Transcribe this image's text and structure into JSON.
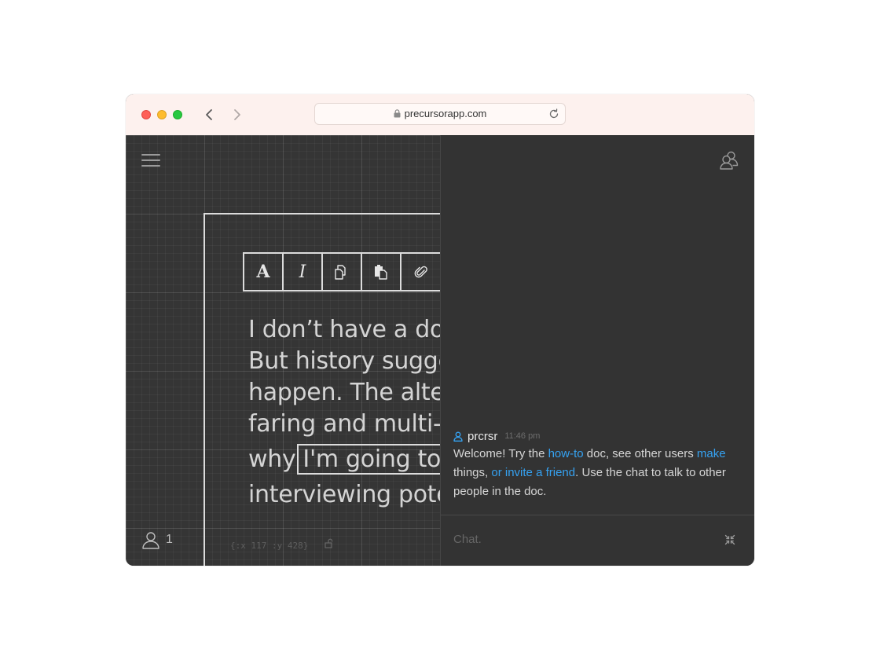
{
  "browser": {
    "url": "precursorapp.com"
  },
  "canvas": {
    "toolbar": {
      "bold_label": "A",
      "italic_label": "I"
    },
    "document_lines": [
      "I don’t have a doc",
      "But history sugge",
      "happen.  The alter",
      "faring and multi-p",
      "why",
      "I'm going to r",
      "interviewing pote"
    ],
    "user_count": "1",
    "coordinates": "{:x 117 :y 428}"
  },
  "chat": {
    "message": {
      "author": "prcrsr",
      "time": "11:46 pm",
      "text_1": "Welcome! Try the ",
      "link_howto": "how-to",
      "text_2": " doc, see other users ",
      "link_make": "make",
      "text_3": "things, ",
      "link_invite": "or invite a friend",
      "text_4": ". Use the chat to talk to other people in the doc."
    },
    "input_placeholder": "Chat."
  },
  "colors": {
    "background": "#333333",
    "link": "#35a2f2",
    "titlebar": "#fdf1ee"
  }
}
